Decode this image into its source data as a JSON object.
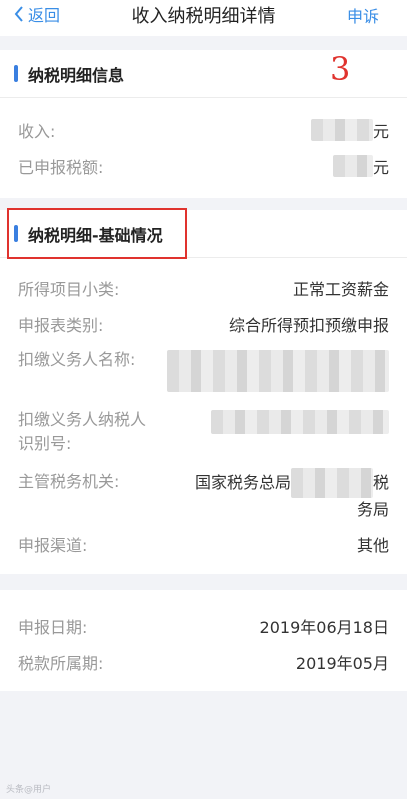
{
  "header": {
    "back_label": "返回",
    "title": "收入纳税明细详情",
    "action_label": "申诉"
  },
  "annotation": {
    "number": "3"
  },
  "section1": {
    "title": "纳税明细信息",
    "income_label": "收入:",
    "income_unit": "元",
    "tax_label": "已申报税额:",
    "tax_unit": "元"
  },
  "section2": {
    "title": "纳税明细-基础情况",
    "rows": [
      {
        "label": "所得项目小类:",
        "value": "正常工资薪金"
      },
      {
        "label": "申报表类别:",
        "value": "综合所得预扣预缴申报"
      },
      {
        "label": "扣缴义务人名称:",
        "value": ""
      },
      {
        "label": "扣缴义务人纳税人识别号:",
        "value": ""
      },
      {
        "label": "主管税务机关:",
        "value": "国家税务总局",
        "value_tail1": "税",
        "value_tail2": "务局"
      },
      {
        "label": "申报渠道:",
        "value": "其他"
      }
    ]
  },
  "section3": {
    "date_label": "申报日期:",
    "date_value": "2019年06月18日",
    "period_label": "税款所属期:",
    "period_value": "2019年05月"
  },
  "watermark": "头条@用户"
}
